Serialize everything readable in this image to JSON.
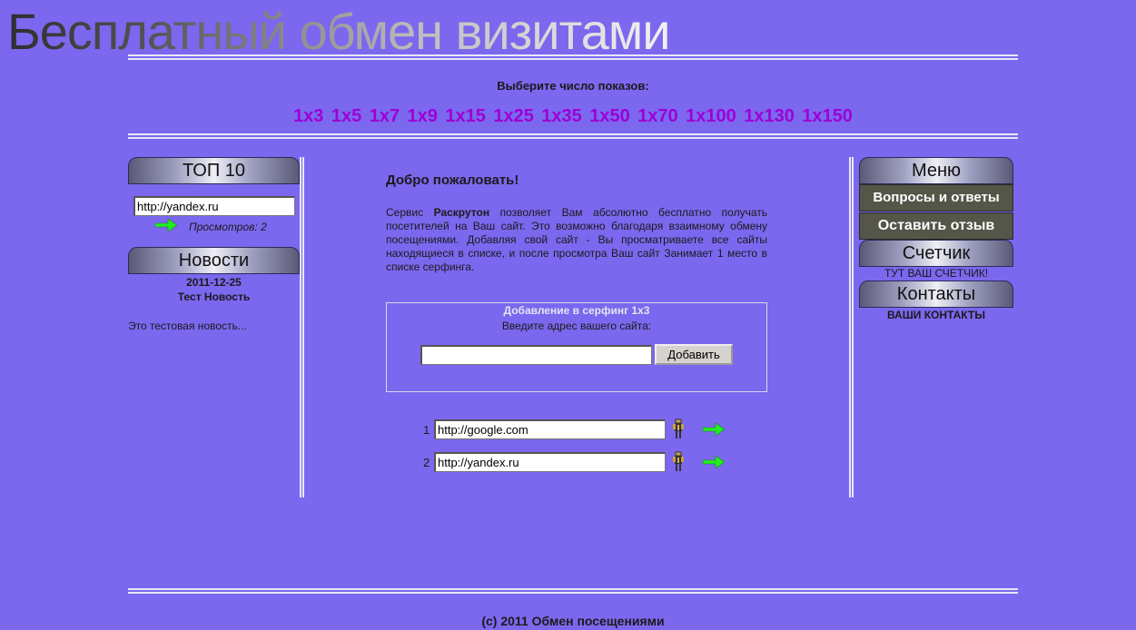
{
  "header": {
    "title": "Бесплатный обмен визитами"
  },
  "counts": {
    "prompt": "Выберите число показов:",
    "options": [
      "1x3",
      "1x5",
      "1x7",
      "1x9",
      "1x15",
      "1x25",
      "1x35",
      "1x50",
      "1x70",
      "1x100",
      "1x130",
      "1x150"
    ]
  },
  "left": {
    "top_header": "ТОП 10",
    "top_site_url": "http://yandex.ru",
    "top_views": "Просмотров: 2",
    "news_header": "Новости",
    "news_date": "2011-12-25",
    "news_title": "Тест Новость",
    "news_text": "Это тестовая новость..."
  },
  "main": {
    "welcome_title": "Добро пожаловать!",
    "welcome_pre": "Сервис ",
    "welcome_brand": "Раскрутон",
    "welcome_post": " позволяет Вам абсолютно бесплатно получать посетителей на Ваш сайт. Это возможно благодаря взаимному обмену посещениями. Добавляя свой сайт - Вы просматриваете все сайты находящиеся в списке, и после просмотра Ваш сайт Занимает 1 место в списке серфинга.",
    "form_title": "Добавление в серфинг 1x3",
    "form_label": "Введите адрес вашего сайта:",
    "url_value": "",
    "add_button": "Добавить",
    "sites": [
      {
        "num": "1",
        "url": "http://google.com"
      },
      {
        "num": "2",
        "url": "http://yandex.ru"
      }
    ]
  },
  "right": {
    "menu_header": "Меню",
    "faq": "Вопросы и ответы",
    "feedback": "Оставить отзыв",
    "counter_header": "Счетчик",
    "counter_text": "ТУТ ВАШ СЧЕТЧИК!",
    "contacts_header": "Контакты",
    "contacts_text": "ВАШИ КОНТАКТЫ"
  },
  "footer": {
    "text": "(c) 2011 Обмен посещениями"
  },
  "colors": {
    "background": "#7b68ee",
    "link": "#9d00d6",
    "arrow": "#22ee22"
  }
}
